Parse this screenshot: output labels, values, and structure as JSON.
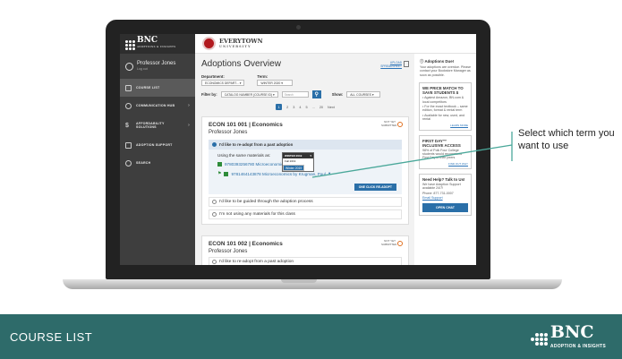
{
  "app": {
    "brand": "BNC",
    "brand_sub": "ADOPTIONS & INSIGHTS",
    "university_name": "EVERYTOWN",
    "university_sub": "UNIVERSITY"
  },
  "sidebar": {
    "user_name": "Professor Jones",
    "user_logout": "Log out",
    "items": [
      {
        "label": "COURSE LIST",
        "icon": "clipboard-icon",
        "active": true
      },
      {
        "label": "COMMUNICATION HUB",
        "icon": "chat-icon",
        "arrow": "›"
      },
      {
        "label": "AFFORDABILITY SOLUTIONS",
        "icon": "dollar-icon",
        "arrow": "›"
      },
      {
        "label": "ADOPTION SUPPORT",
        "icon": "help-icon"
      },
      {
        "label": "SEARCH",
        "icon": "search-icon"
      }
    ]
  },
  "main": {
    "title": "Adoptions Overview",
    "upload_link": "UPLOAD SPREADSHEET",
    "department_label": "Department:",
    "department_value": "ECONOMICS DEPART...",
    "term_label": "Term:",
    "term_value": "WINTER 2020",
    "filter_label": "Filter by:",
    "filter_value": "CATALOG NUMBER (COURSE ID)",
    "search_placeholder": "Search",
    "show_label": "Show:",
    "show_value": "ALL COURSES",
    "pages": [
      "1",
      "2",
      "3",
      "4",
      "5",
      "...",
      "20",
      "Next"
    ],
    "current_page": "1"
  },
  "course1": {
    "title": "ECON 101 001 | Economics",
    "professor": "Professor Jones",
    "status": "NOT YET SUBMITTED",
    "option_readopt": "I'd like to re-adopt from a past adoption",
    "same_materials": "Using the same materials as:",
    "material1": "9780393256780 Microeconomics...",
    "material2": "9781464143878 Microeconomics by Krugman, Paul",
    "readopt_button": "ONE CLICK RE-ADOPT",
    "option_guided": "I'd like to be guided through the adoption process",
    "option_none": "I'm not using any materials for this class",
    "term_dropdown": {
      "selected": "WINTER 2019",
      "options": [
        "Fall 2019",
        "Winter 2019"
      ]
    }
  },
  "course2": {
    "title": "ECON 101 002 | Economics",
    "professor": "Professor Jones",
    "status": "NOT YET SUBMITTED",
    "option_readopt": "I'd like to re-adopt from a past adoption"
  },
  "rightbar": {
    "due_title": "Adoptions Due!",
    "due_text": "Your adoptions are overdue. Please contact your Bookstore Manager as soon as possible.",
    "price_title": "WE PRICE MATCH TO SAVE STUDENTS $",
    "price_bullets": [
      "Against Amazon, BN.com & local competitors",
      "For the exact textbook – same edition, format & rental term",
      "Available for new, used, and rental"
    ],
    "price_link": "LEARN MORE",
    "firstday_title": "FIRST DAY™ INCLUSIVE ACCESS",
    "firstday_text": "98% of Polk Four College students would recommend First Day to their peers",
    "firstday_link": "FIND OUT WHY",
    "help_title": "Need Help? Talk to Us!",
    "help_text": "We have Adoption Support available 24/7!",
    "help_phone": "Phone: 877-731-0007",
    "help_email": "Email Support",
    "help_button": "OPEN CHAT"
  },
  "callout": {
    "text": "Select which term you want to use"
  },
  "footer": {
    "title": "COURSE LIST",
    "brand": "BNC",
    "brand_tag": "ADOPTION & INSIGHTS"
  },
  "colors": {
    "footer": "#2e6b6a",
    "primary": "#2a6fa8",
    "university": "#b2191e",
    "callout_line": "#4aa89a"
  }
}
